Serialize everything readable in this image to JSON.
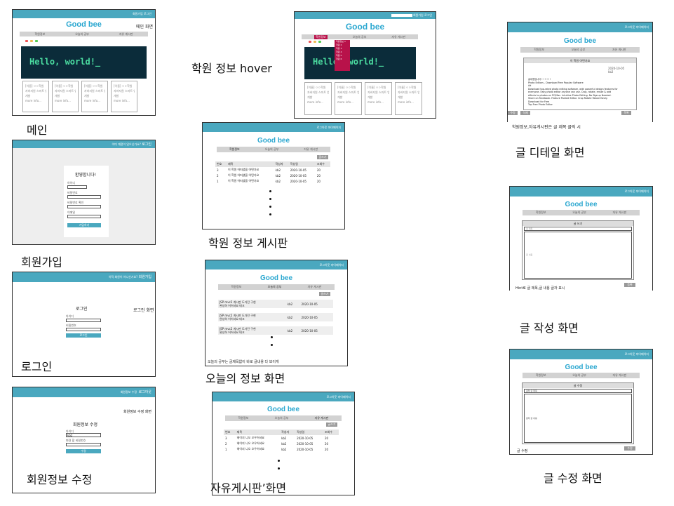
{
  "site_logo": "Good bee",
  "hero_text": "Hello, world!_",
  "nav": [
    "학원정보",
    "오늘의 공부",
    "자유 게시판"
  ],
  "nav_today_detail": [
    "학원정보",
    "오늘의 공부",
    "자유 게시판"
  ],
  "captions": {
    "main": "메인",
    "signup": "회원가입",
    "login": "로그인",
    "edit_member": "회원정보 수정",
    "hover": "학원 정보  hover",
    "academy_board": "학원 정보 게시판",
    "today_info": "오늘의 정보 화면",
    "free_board": "자유게시판’화면",
    "detail": "글 디테일 화면",
    "write": "글 작성 화면",
    "edit_post": "글 수정 화면"
  },
  "header_links": {
    "main": "회원가입 로그인",
    "signup": "이미 계정이 있으신가요?",
    "signup_link": "로그인",
    "login": "아직 회원이 아니신가요?",
    "login_link": "회원가입",
    "edit": "회원정보 수정",
    "edit2": "로그아웃",
    "board": "로그아웃 마이페이지"
  },
  "labels": {
    "main_screen": "메인 화면",
    "welcome": "환영합니다!",
    "id": "아이디",
    "pw": "비밀번호",
    "pw_confirm": "비밀번호 확인",
    "name": "이메일",
    "signup_btn": "가입하기",
    "login_title": "로그인",
    "login_screen": "로그인 화면",
    "login_btn": "로그인",
    "edit_title": "회원정보 수정",
    "edit_screen": "회원정보 수정 화면",
    "edit_id": "아이디",
    "edit_id_val": "kb2",
    "edit_pw": "변경 할 비밀번호",
    "edit_btn": "수정",
    "write_btn": "글쓰기",
    "card_title": "[이름] ㅇㅇ학원",
    "card_desc1": "자바지원 스마트 앱",
    "card_desc2": "개발",
    "card_more": "more info...",
    "detail_note": "학원정보,자유게시판은 글 제목 클릭 시",
    "detail_post_title": "이 학원 어떤가요",
    "detail_date": "2020-10-05",
    "detail_author": "kb2",
    "detail_body": [
      "글내용입니다 ! ! ! ! ! !",
      "Photo Editors - Download Free Popular Software",
      "",
      "Download top-rated photo editing software, with powerful design features for",
      "everyone. Easy photo editor anyone can use. Crop, rotate, resize & add",
      "effects to photos on PC/Mac. Intuitive Photo Editing. No Signup Needed.",
      "Share on Facebook. Feature Packed Editor. Crop Rotate Resize Easily.",
      "Download for Free",
      "Top Free Photo Editor"
    ],
    "detail_edit": "수정",
    "detail_del": "삭제",
    "detail_list": "목록",
    "write_title": "글 쓰기",
    "write_ph_title": "글 제목",
    "write_ph_body": "글 내용",
    "write_hint": "Hint로 글 제목,글 내용 글자 표시",
    "write_btn2": "등록",
    "edit_post_title": "글 수정",
    "edit_post_ph_title": "원래 글 제목",
    "edit_post_ph_body": "원래 글 내용",
    "edit_post_bottom": "글 수정",
    "edit_post_btn": "수정",
    "today_note": "오늘의 공부는 글제목없이 바로 글내용 다 보이게"
  },
  "board_cols": [
    "번호",
    "제목",
    "작성자",
    "작성일",
    "조회수"
  ],
  "academy_rows": [
    [
      "3",
      "이 학원 어떠셨을 어떤가요",
      "kb2",
      "2020-10-05",
      "20"
    ],
    [
      "2",
      "이 학원 어떠셨을 어떤가요",
      "kb2",
      "2020-10-05",
      "20"
    ],
    [
      "1",
      "이 학원 어떠셨을 어떤가요",
      "kb2",
      "2020-10-05",
      "20"
    ]
  ],
  "free_rows": [
    [
      "3",
      "헤이지 니오 오우어셔요",
      "kb2",
      "2020-10-05",
      "20"
    ],
    [
      "2",
      "헤이지 니오 오우어셔요",
      "kb2",
      "2020-10-05",
      "20"
    ],
    [
      "1",
      "헤이지 니오 오우어셔요",
      "kb2",
      "2020-10-05",
      "20"
    ]
  ],
  "today_rows": [
    [
      "JSP mvc2 게시판 도가던 구현",
      "완성하 어어셔요 테크",
      "kb2",
      "2020-10-05"
    ],
    [
      "JSP mvc2 게시판 도가던 구현",
      "완성하 어어셔요 테크",
      "kb2",
      "2020-10-05"
    ],
    [
      "JSP mvc2 게시판 도가던 구현",
      "완성하 어어셔요 테크",
      "kb2",
      "2020-10-05"
    ]
  ],
  "hover_menu": [
    "학원정보 1",
    "학원 2",
    "학원 3",
    "학원 4",
    "학원 5",
    "학원 6"
  ],
  "colors": {
    "header": "#4aa8bf",
    "logo": "#2aa7d0",
    "hero": "#0b2c3a",
    "hero_text": "#4bdca0"
  }
}
